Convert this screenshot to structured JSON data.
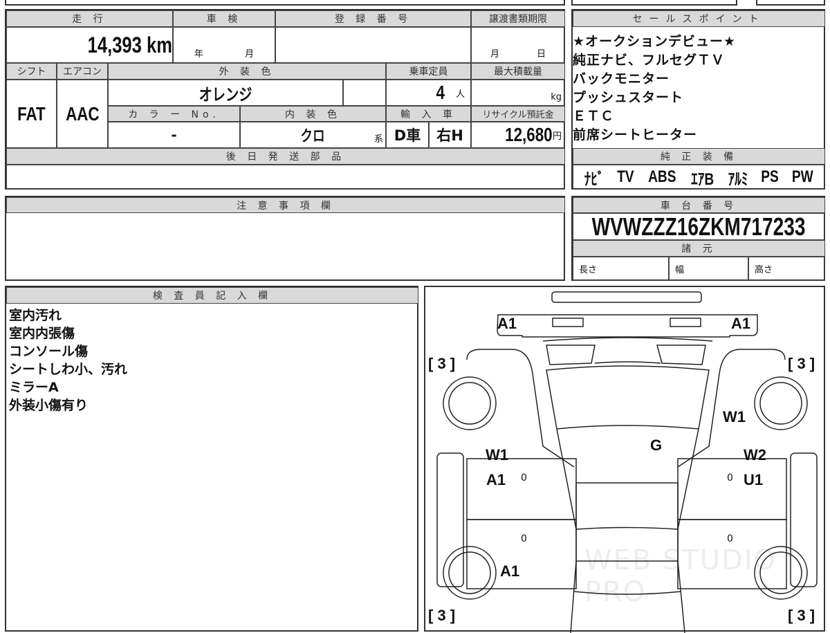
{
  "sheet": {
    "mileage_label": "走 行",
    "mileage": "14,393 km",
    "inspection_label": "車 検",
    "inspection_year": "年",
    "inspection_month": "月",
    "reg_label": "登 録 番 号",
    "transfer_label": "譲渡書類期限",
    "transfer_month": "月",
    "transfer_day": "日",
    "shift_label": "シフト",
    "ac_label": "エアコン",
    "exterior_label": "外 装 色",
    "capacity_label": "乗車定員",
    "maxload_label": "最大積載量",
    "shift": "FAT",
    "ac": "AAC",
    "exterior": "オレンジ",
    "capacity": "4",
    "capacity_unit": "人",
    "maxload_unit": "kg",
    "colorno_label": "カ ラ ー No.",
    "interior_label": "内 装 色",
    "import_label": "輸 入 車",
    "recycle_label": "リサイクル預託金",
    "colorno": "-",
    "interior": "クロ",
    "interior_suffix": "系",
    "import_d": "D車",
    "import_h": "右H",
    "recycle": "12,680",
    "recycle_unit": "円",
    "later_parts_label": "後 日 発 送 部 品"
  },
  "sales": {
    "label": "セールスポイント",
    "lines": [
      "★オークションデビュー★",
      "純正ナビ、フルセグＴＶ",
      "バックモニター",
      "プッシュスタート",
      "ＥＴＣ",
      "前席シートヒーター"
    ]
  },
  "equipment": {
    "label": "純 正 装 備",
    "items": [
      "ﾅﾋﾞ",
      "TV",
      "ABS",
      "ｴｱB",
      "ｱﾙﾐ",
      "PS",
      "PW"
    ]
  },
  "caution": {
    "label": "注 意 事 項 欄"
  },
  "chassis": {
    "label": "車 台 番 号",
    "vin": "WVWZZZ16ZKM717233",
    "spec_label": "諸 元",
    "length": "長さ",
    "width": "幅",
    "height": "高さ"
  },
  "inspector": {
    "label": "検 査 員 記 入 欄",
    "notes": [
      "室内汚れ",
      "室内内張傷",
      "コンソール傷",
      "シートしわ小、汚れ",
      "ミラーA",
      "外装小傷有り"
    ]
  },
  "diagram": {
    "codes": [
      "A1",
      "A1",
      "W1",
      "G",
      "W1",
      "A1",
      "W2",
      "U1",
      "A1"
    ],
    "tires": [
      "[ 3 ]",
      "[ 3 ]",
      "[ 3 ]",
      "[ 3 ]"
    ],
    "zeros": [
      "0",
      "0",
      "0",
      "0"
    ],
    "watermark": "WEB STUDIO PRO"
  }
}
